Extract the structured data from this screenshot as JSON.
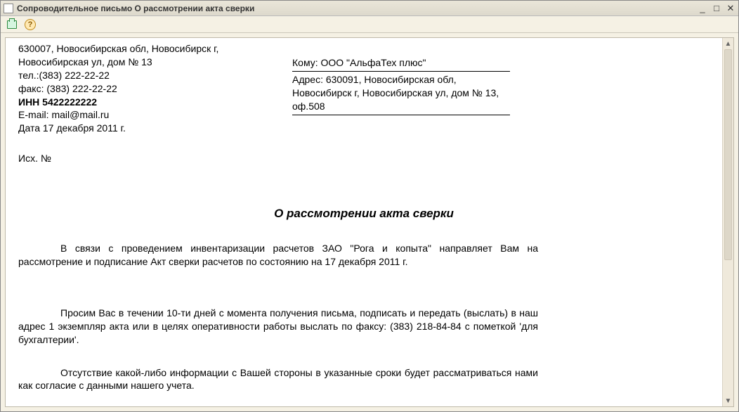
{
  "window": {
    "title": "Сопроводительное письмо О рассмотрении акта сверки"
  },
  "toolbar": {
    "helpGlyph": "?"
  },
  "sender": {
    "address": "630007, Новосибирская обл, Новосибирск г, Новосибирская ул, дом № 13",
    "phone": "тел.:(383) 222-22-22",
    "fax": "факс: (383) 222-22-22",
    "inn": "ИНН 5422222222",
    "email": "E-mail: mail@mail.ru",
    "date": "Дата  17 декабря 2011 г."
  },
  "recipient": {
    "to": "Кому: ООО \"АльфаТех плюс\"",
    "address": "Адрес: 630091, Новосибирская обл, Новосибирск г, Новосибирская ул, дом № 13, оф.508"
  },
  "outgoing": "Исх. №",
  "documentTitle": "О рассмотрении акта сверки",
  "body": {
    "p1": "В связи с проведением инвентаризации расчетов ЗАО \"Рога и копыта\" направляет Вам на рассмотрение и подписание Акт сверки расчетов  по состоянию на 17 декабря 2011 г.",
    "p2": "Просим Вас в течении 10-ти дней с момента получения письма, подписать и передать (выслать) в наш адрес 1 экземпляр акта или в целях оперативности работы выслать по факсу: (383) 218-84-84 с пометкой 'для бухгалтерии'.",
    "p3": "Отсутствие какой-либо информации с Вашей стороны в указанные сроки будет рассматриваться нами как согласие с данными нашего учета."
  }
}
